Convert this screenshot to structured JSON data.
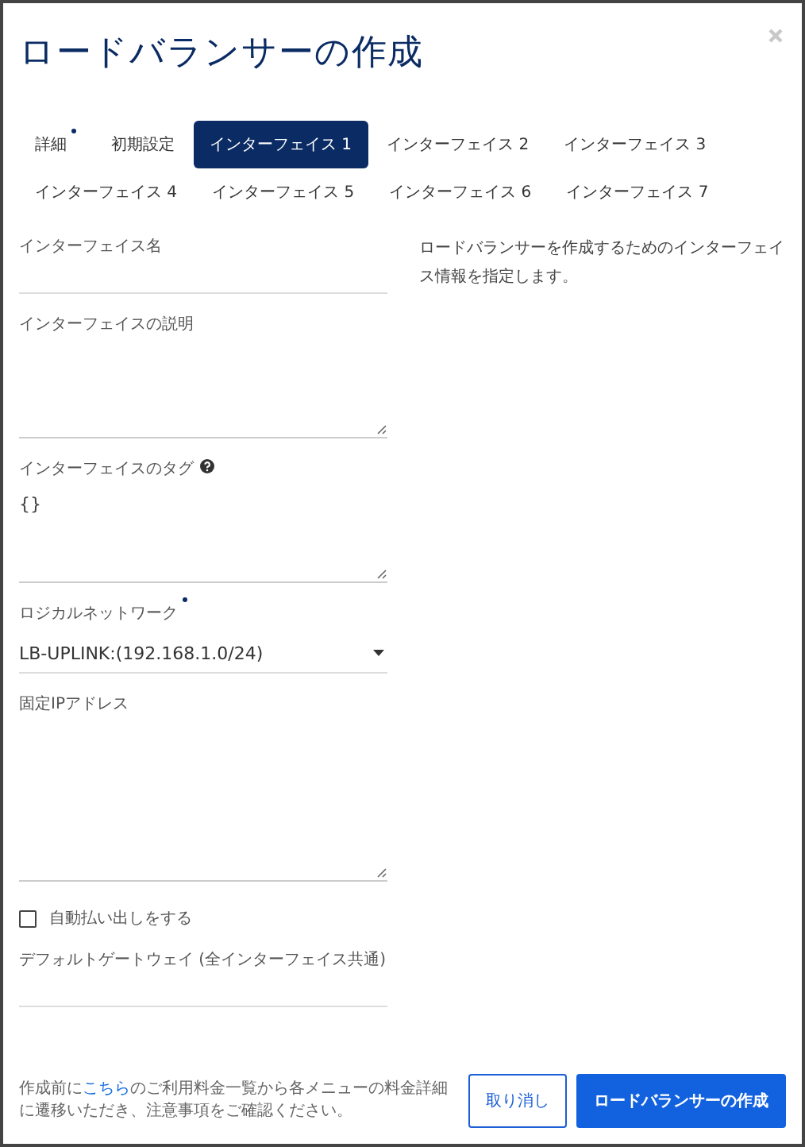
{
  "dialog": {
    "title": "ロードバランサーの作成"
  },
  "tabs": [
    {
      "label": "詳細",
      "selected": false,
      "required": true
    },
    {
      "label": "初期設定",
      "selected": false,
      "required": false
    },
    {
      "label": "インターフェイス 1",
      "selected": true,
      "required": false
    },
    {
      "label": "インターフェイス 2",
      "selected": false,
      "required": false
    },
    {
      "label": "インターフェイス 3",
      "selected": false,
      "required": false
    },
    {
      "label": "インターフェイス 4",
      "selected": false,
      "required": false
    },
    {
      "label": "インターフェイス 5",
      "selected": false,
      "required": false
    },
    {
      "label": "インターフェイス 6",
      "selected": false,
      "required": false
    },
    {
      "label": "インターフェイス 7",
      "selected": false,
      "required": false
    }
  ],
  "fields": [
    {
      "kind": "text",
      "label": "インターフェイス名",
      "required": false
    },
    {
      "kind": "textarea",
      "label": "インターフェイスの説明",
      "required": false
    },
    {
      "kind": "textarea",
      "label": "インターフェイスのタグ",
      "required": false,
      "help": true,
      "value": "{}"
    },
    {
      "kind": "select",
      "label": "ロジカルネットワーク",
      "required": true,
      "value": "LB-UPLINK:(192.168.1.0/24)"
    },
    {
      "kind": "textarea",
      "label": "固定IPアドレス",
      "required": false
    },
    {
      "kind": "checkbox",
      "label": "自動払い出しをする",
      "checked": false
    },
    {
      "kind": "text",
      "label": "デフォルトゲートウェイ (全インターフェイス共通)",
      "required": false
    }
  ],
  "description": "ロードバランサーを作成するためのインターフェイス情報を指定します。",
  "note": {
    "before": "作成前に",
    "link": "こちら",
    "after": "のご利用料金一覧から各メニューの料金詳細に遷移いただき、注意事項をご確認ください。"
  },
  "buttons": [
    {
      "label": "取り消し",
      "kind": "secondary"
    },
    {
      "label": "ロードバランサーの作成",
      "kind": "primary"
    }
  ]
}
